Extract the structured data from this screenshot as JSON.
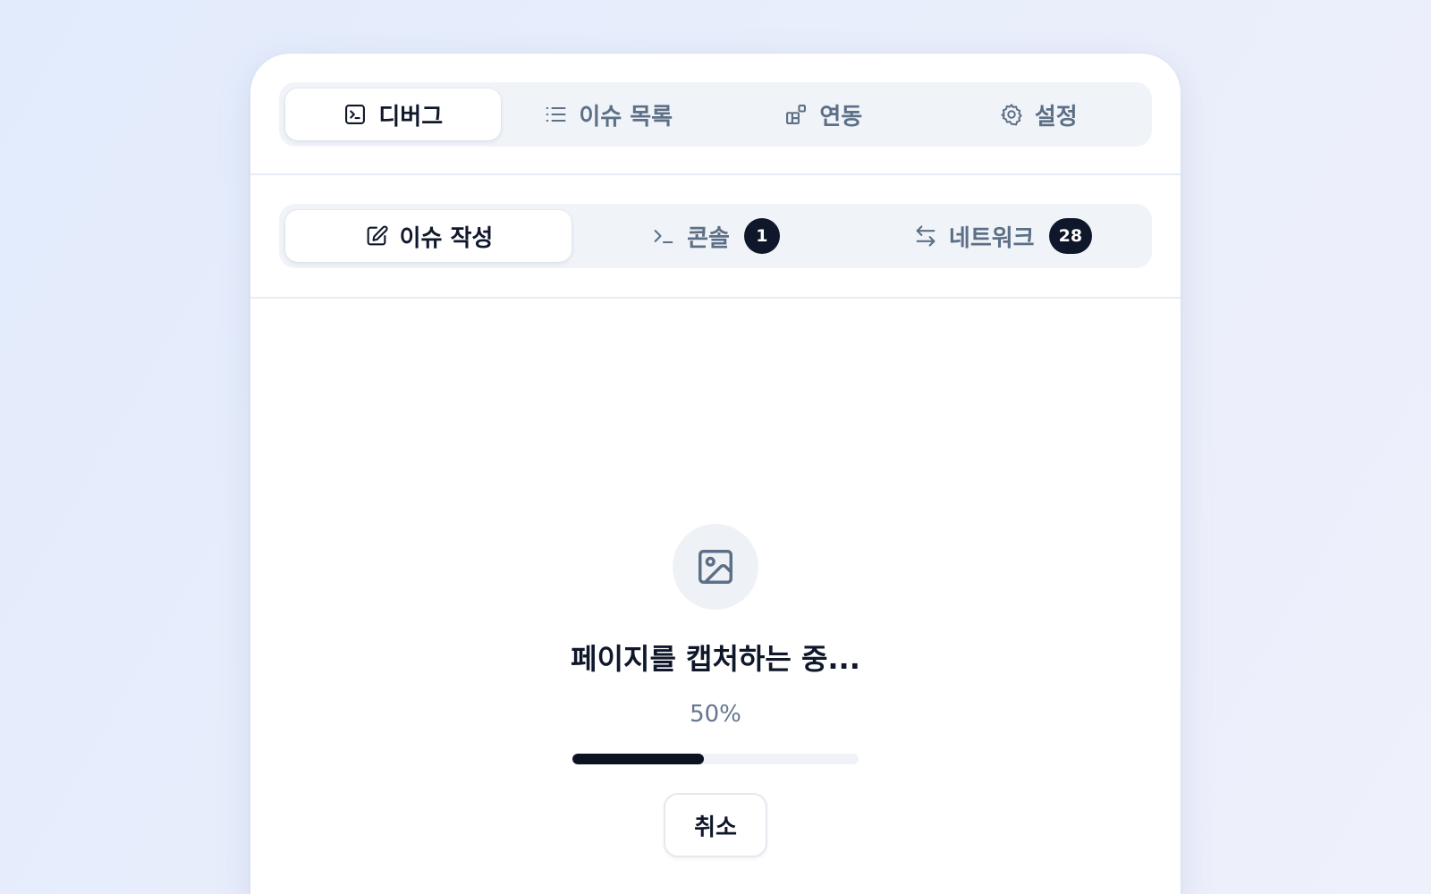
{
  "main_tabs": [
    {
      "label": "디버그",
      "icon": "terminal-square-icon",
      "active": true
    },
    {
      "label": "이슈 목록",
      "icon": "list-icon",
      "active": false
    },
    {
      "label": "연동",
      "icon": "blocks-icon",
      "active": false
    },
    {
      "label": "설정",
      "icon": "gear-icon",
      "active": false
    }
  ],
  "sub_tabs": [
    {
      "label": "이슈 작성",
      "icon": "edit-icon",
      "active": true
    },
    {
      "label": "콘솔",
      "icon": "console-icon",
      "badge": "1",
      "active": false
    },
    {
      "label": "네트워크",
      "icon": "arrows-exchange-icon",
      "badge": "28",
      "active": false
    }
  ],
  "capture": {
    "icon": "image-icon",
    "title": "페이지를 캡처하는 중...",
    "percent_text": "50%",
    "progress": 0.46,
    "cancel_label": "취소"
  },
  "colors": {
    "accent_dark": "#0f172a",
    "muted_text": "#5d6f86",
    "tabbar_bg": "#f0f4f9"
  }
}
